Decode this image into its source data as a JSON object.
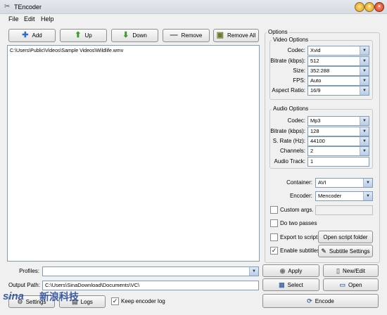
{
  "window": {
    "title": "TEncoder"
  },
  "menu": [
    "File",
    "Edit",
    "Help"
  ],
  "toolbar": {
    "add": "Add",
    "up": "Up",
    "down": "Down",
    "remove": "Remove",
    "remove_all": "Remove All"
  },
  "files": [
    "C:\\Users\\Public\\Videos\\Sample Videos\\Wildlife.wmv"
  ],
  "options": {
    "title": "Options",
    "video": {
      "title": "Video Options",
      "codec_label": "Codec:",
      "codec": "Xvid",
      "bitrate_label": "Bitrate (kbps):",
      "bitrate": "512",
      "size_label": "Size:",
      "size": "352:288",
      "fps_label": "FPS:",
      "fps": "Auto",
      "aspect_label": "Aspect Ratio:",
      "aspect": "16/9"
    },
    "audio": {
      "title": "Audio Options",
      "codec_label": "Codec:",
      "codec": "Mp3",
      "bitrate_label": "Bitrate (kbps):",
      "bitrate": "128",
      "srate_label": "S. Rate (Hz):",
      "srate": "44100",
      "channels_label": "Channels:",
      "channels": "2",
      "track_label": "Audio Track:",
      "track": "1"
    },
    "container_label": "Container:",
    "container": "AVI",
    "encoder_label": "Encoder:",
    "encoder": "Mencoder",
    "custom_args_label": "Custom args.",
    "custom_args_checked": false,
    "two_passes_label": "Do two passes",
    "two_passes_checked": false,
    "export_label": "Export to script",
    "export_checked": false,
    "open_script_folder": "Open script folder",
    "subtitles_label": "Enable subtitles",
    "subtitles_checked": true,
    "subtitle_settings": "Subtitle Settings"
  },
  "bottom": {
    "profiles_label": "Profiles:",
    "profiles_value": "",
    "output_label": "Output Path:",
    "output_value": "C:\\Users\\SinaDownload\\Documents\\VC\\",
    "settings": "Settings",
    "logs": "Logs",
    "keep_log_label": "Keep encoder log",
    "keep_log_checked": true,
    "apply": "Apply",
    "new_edit": "New/Edit",
    "select": "Select",
    "open": "Open",
    "encode": "Encode"
  },
  "watermark": {
    "brand": "sina",
    "cn": "新浪科技"
  },
  "colors": {
    "accent": "#2b4f9a",
    "list_border": "#7f9db9"
  }
}
